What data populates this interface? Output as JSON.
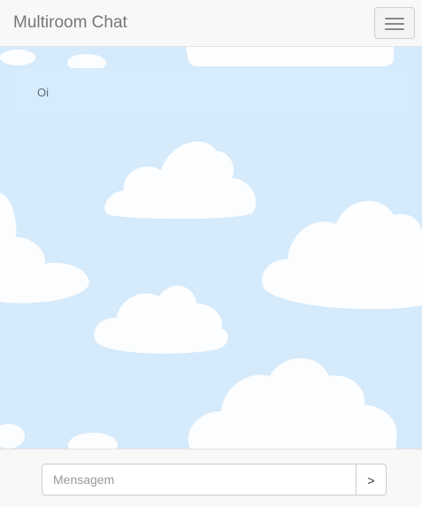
{
  "navbar": {
    "brand": "Multiroom Chat",
    "menu_icon": "hamburger-menu-icon"
  },
  "chat": {
    "messages": [
      {
        "text": "Oi"
      }
    ],
    "background": "sky-clouds-pattern"
  },
  "composer": {
    "placeholder": "Mensagem",
    "value": "",
    "send_label": ">"
  },
  "colors": {
    "navbar_bg": "#f8f8f8",
    "brand_text": "#777777",
    "sky": "#d5eafb",
    "message_bg": "#d6ebfd"
  }
}
